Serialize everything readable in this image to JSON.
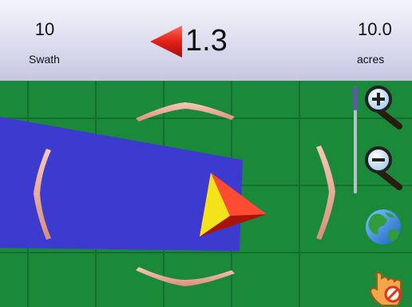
{
  "header": {
    "swath_value": "10",
    "swath_label": "Swath",
    "offset_value": "1.3",
    "offset_direction": "left",
    "area_value": "10.0",
    "area_label": "acres"
  },
  "map": {
    "field_color": "#1a8a3a",
    "coverage_color": "#3d3ad0",
    "vehicle_color": "#e32b1f",
    "vehicle_heading": "right"
  },
  "sidebar": {
    "buttons": [
      {
        "icon": "zoom-in-icon"
      },
      {
        "icon": "zoom-out-icon"
      },
      {
        "icon": "globe-icon"
      },
      {
        "icon": "hand-pan-icon"
      }
    ]
  },
  "colors": {
    "header_bg": "#dcdcef",
    "offset_arrow": "#e02020",
    "nav_chevron": "#f0b0a0"
  }
}
